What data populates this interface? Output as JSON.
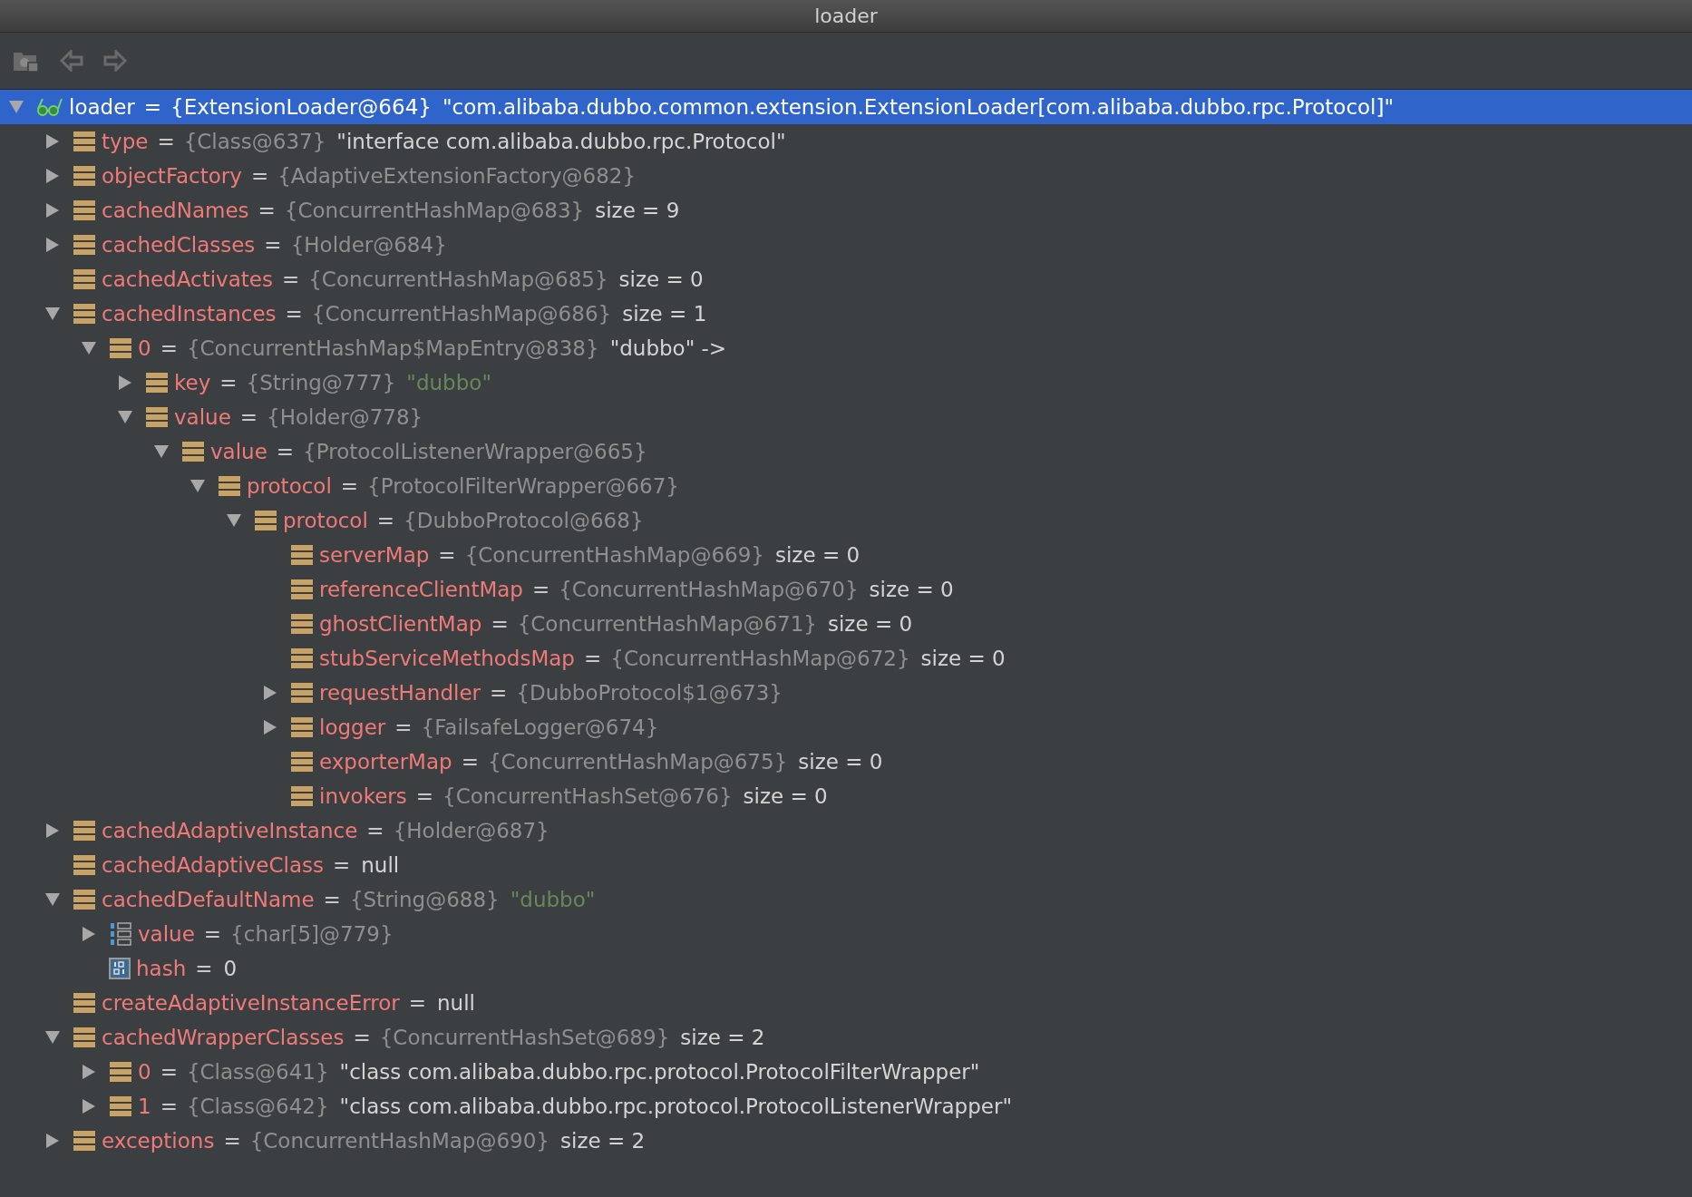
{
  "window": {
    "title": "loader"
  },
  "tree": [
    {
      "name": "loader",
      "kind": "watch",
      "selected": true,
      "expanded": true,
      "eq": "=",
      "ref": "{ExtensionLoader@664}",
      "value": "\"com.alibaba.dubbo.common.extension.ExtensionLoader[com.alibaba.dubbo.rpc.Protocol]\"",
      "children": [
        {
          "name": "type",
          "kind": "field",
          "selected": false,
          "expanded": false,
          "eq": "=",
          "ref": "{Class@637}",
          "value": "\"interface com.alibaba.dubbo.rpc.Protocol\"",
          "string_literal": false
        },
        {
          "name": "objectFactory",
          "kind": "field",
          "selected": false,
          "expanded": false,
          "eq": "=",
          "ref": "{AdaptiveExtensionFactory@682}"
        },
        {
          "name": "cachedNames",
          "kind": "field",
          "selected": false,
          "expanded": false,
          "eq": "=",
          "ref": "{ConcurrentHashMap@683}",
          "value": "size = 9",
          "string_literal": false
        },
        {
          "name": "cachedClasses",
          "kind": "field",
          "selected": false,
          "expanded": false,
          "eq": "=",
          "ref": "{Holder@684}"
        },
        {
          "name": "cachedActivates",
          "kind": "field",
          "selected": false,
          "eq": "=",
          "ref": "{ConcurrentHashMap@685}",
          "value": "size = 0",
          "string_literal": false
        },
        {
          "name": "cachedInstances",
          "kind": "field",
          "selected": false,
          "expanded": true,
          "eq": "=",
          "ref": "{ConcurrentHashMap@686}",
          "value": "size = 1",
          "string_literal": false,
          "children": [
            {
              "name": "0",
              "kind": "field",
              "selected": false,
              "expanded": true,
              "eq": "=",
              "ref": "{ConcurrentHashMap$MapEntry@838}",
              "value": "\"dubbo\" ->",
              "string_literal": false,
              "children": [
                {
                  "name": "key",
                  "kind": "field",
                  "selected": false,
                  "expanded": false,
                  "eq": "=",
                  "ref": "{String@777}",
                  "value": "\"dubbo\"",
                  "string_literal": true
                },
                {
                  "name": "value",
                  "kind": "field",
                  "selected": false,
                  "expanded": true,
                  "eq": "=",
                  "ref": "{Holder@778}",
                  "children": [
                    {
                      "name": "value",
                      "kind": "field",
                      "selected": false,
                      "expanded": true,
                      "eq": "=",
                      "ref": "{ProtocolListenerWrapper@665}",
                      "children": [
                        {
                          "name": "protocol",
                          "kind": "field",
                          "selected": false,
                          "expanded": true,
                          "eq": "=",
                          "ref": "{ProtocolFilterWrapper@667}",
                          "children": [
                            {
                              "name": "protocol",
                              "kind": "field",
                              "selected": false,
                              "expanded": true,
                              "eq": "=",
                              "ref": "{DubboProtocol@668}",
                              "children": [
                                {
                                  "name": "serverMap",
                                  "kind": "field",
                                  "selected": false,
                                  "eq": "=",
                                  "ref": "{ConcurrentHashMap@669}",
                                  "value": "size = 0",
                                  "string_literal": false
                                },
                                {
                                  "name": "referenceClientMap",
                                  "kind": "field",
                                  "selected": false,
                                  "eq": "=",
                                  "ref": "{ConcurrentHashMap@670}",
                                  "value": "size = 0",
                                  "string_literal": false
                                },
                                {
                                  "name": "ghostClientMap",
                                  "kind": "field",
                                  "selected": false,
                                  "eq": "=",
                                  "ref": "{ConcurrentHashMap@671}",
                                  "value": "size = 0",
                                  "string_literal": false
                                },
                                {
                                  "name": "stubServiceMethodsMap",
                                  "kind": "field",
                                  "selected": false,
                                  "eq": "=",
                                  "ref": "{ConcurrentHashMap@672}",
                                  "value": "size = 0",
                                  "string_literal": false
                                },
                                {
                                  "name": "requestHandler",
                                  "kind": "field",
                                  "selected": false,
                                  "expanded": false,
                                  "eq": "=",
                                  "ref": "{DubboProtocol$1@673}"
                                },
                                {
                                  "name": "logger",
                                  "kind": "field",
                                  "selected": false,
                                  "expanded": false,
                                  "eq": "=",
                                  "ref": "{FailsafeLogger@674}"
                                },
                                {
                                  "name": "exporterMap",
                                  "kind": "field",
                                  "selected": false,
                                  "eq": "=",
                                  "ref": "{ConcurrentHashMap@675}",
                                  "value": "size = 0",
                                  "string_literal": false
                                },
                                {
                                  "name": "invokers",
                                  "kind": "field",
                                  "selected": false,
                                  "eq": "=",
                                  "ref": "{ConcurrentHashSet@676}",
                                  "value": "size = 0",
                                  "string_literal": false
                                }
                              ]
                            }
                          ]
                        }
                      ]
                    }
                  ]
                }
              ]
            }
          ]
        },
        {
          "name": "cachedAdaptiveInstance",
          "kind": "field",
          "selected": false,
          "expanded": false,
          "eq": "=",
          "ref": "{Holder@687}"
        },
        {
          "name": "cachedAdaptiveClass",
          "kind": "field",
          "selected": false,
          "eq": "=",
          "value": "null",
          "string_literal": false
        },
        {
          "name": "cachedDefaultName",
          "kind": "field",
          "selected": false,
          "expanded": true,
          "eq": "=",
          "ref": "{String@688}",
          "value": "\"dubbo\"",
          "string_literal": true,
          "children": [
            {
              "name": "value",
              "kind": "array",
              "selected": false,
              "expanded": false,
              "eq": "=",
              "ref": "{char[5]@779}"
            },
            {
              "name": "hash",
              "kind": "primitive",
              "selected": false,
              "eq": "=",
              "value": "0",
              "string_literal": false
            }
          ]
        },
        {
          "name": "createAdaptiveInstanceError",
          "kind": "field",
          "selected": false,
          "eq": "=",
          "value": "null",
          "string_literal": false
        },
        {
          "name": "cachedWrapperClasses",
          "kind": "field",
          "selected": false,
          "expanded": true,
          "eq": "=",
          "ref": "{ConcurrentHashSet@689}",
          "value": "size = 2",
          "string_literal": false,
          "children": [
            {
              "name": "0",
              "kind": "field",
              "selected": false,
              "expanded": false,
              "eq": "=",
              "ref": "{Class@641}",
              "value": "\"class com.alibaba.dubbo.rpc.protocol.ProtocolFilterWrapper\"",
              "string_literal": false
            },
            {
              "name": "1",
              "kind": "field",
              "selected": false,
              "expanded": false,
              "eq": "=",
              "ref": "{Class@642}",
              "value": "\"class com.alibaba.dubbo.rpc.protocol.ProtocolListenerWrapper\"",
              "string_literal": false
            }
          ]
        },
        {
          "name": "exceptions",
          "kind": "field",
          "selected": false,
          "expanded": false,
          "eq": "=",
          "ref": "{ConcurrentHashMap@690}",
          "value": "size = 2",
          "string_literal": false
        }
      ]
    }
  ]
}
